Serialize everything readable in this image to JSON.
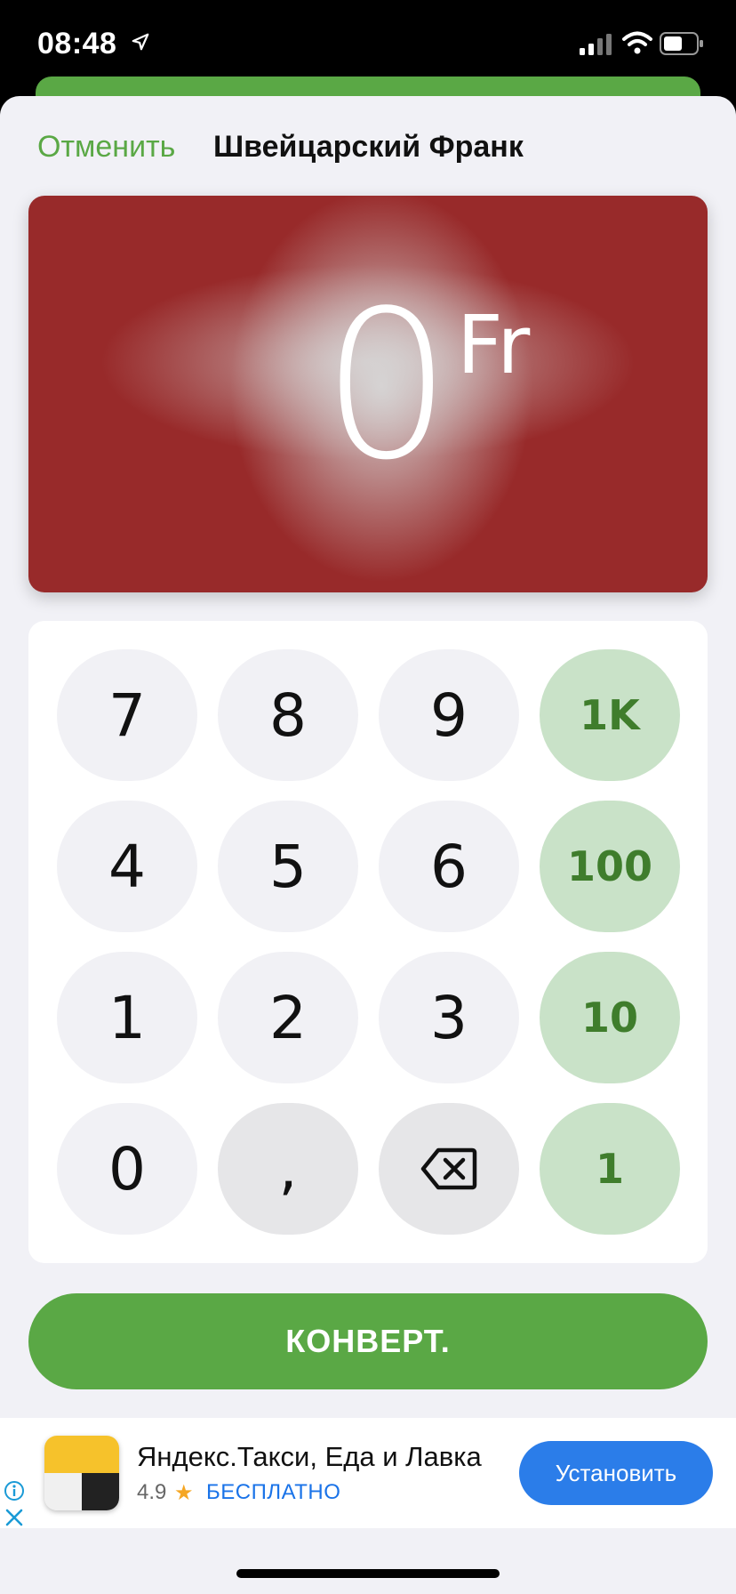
{
  "status_bar": {
    "time": "08:48",
    "icons": [
      "location-arrow-icon",
      "signal-icon",
      "wifi-icon",
      "battery-icon"
    ]
  },
  "nav": {
    "cancel_label": "Отменить",
    "title": "Швейцарский Франк"
  },
  "display": {
    "amount": "0",
    "currency_symbol": "Fr",
    "card_color": "#982a2a"
  },
  "keypad": {
    "digits": [
      "7",
      "8",
      "9",
      "4",
      "5",
      "6",
      "1",
      "2",
      "3",
      "0",
      ","
    ],
    "quick_add": [
      "1K",
      "100",
      "10",
      "1"
    ],
    "backspace_icon": "backspace-icon"
  },
  "convert_label": "КОНВЕРТ.",
  "ad": {
    "title": "Яндекс.Такси, Еда и Лавка",
    "rating": "4.9",
    "price": "БЕСПЛАТНО",
    "install_label": "Установить"
  },
  "colors": {
    "accent": "#5aa845",
    "quick_key_bg": "#c9e2c8",
    "install_blue": "#2b7de9"
  }
}
